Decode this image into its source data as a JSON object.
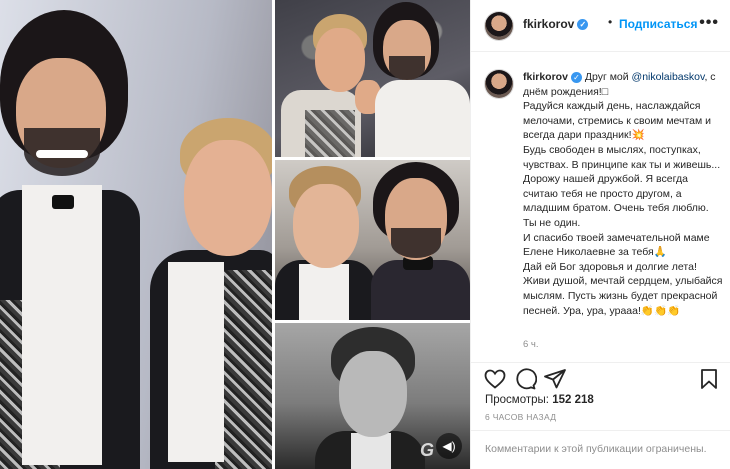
{
  "post": {
    "username": "fkirkorov",
    "follow_label": "Подписаться",
    "dot": "•",
    "more_glyph": "•••",
    "verified_glyph": "✓",
    "caption_user": "fkirkorov",
    "caption_pre": "Друг мой ",
    "caption_mention": "@nikolaibaskov",
    "caption_line1": ", с днём рождения!□",
    "caption_body1": "Радуйся каждый день, наслаждайся мелочами, стремись к своим мечтам и всегда дари праздник!",
    "caption_emoji1": "💥",
    "caption_body2": "Будь свободен в мыслях, поступках, чувствах. В принципе как ты и живешь... Дорожу нашей дружбой. Я всегда считаю тебя не просто другом, а младшим братом. Очень тебя люблю. Ты не один.\nИ спасибо твоей замечательной маме Елене Николаевне за тебя",
    "caption_emoji2": "🙏",
    "caption_body3": "Дай ей Бог здоровья и долгие лета!\nЖиви душой, мечтай сердцем, улыбайся мыслям. Пусть жизнь будет прекрасной песней. Ура, ура, урааа!",
    "caption_emoji3": "👏👏👏",
    "time_short": "6 ч.",
    "views_label": "Просмотры:",
    "views_count": "152 218",
    "time_ago": "6 ЧАСОВ НАЗАД",
    "comments_disabled": "Комментарии к этой публикации ограничены.",
    "watermark": "G",
    "play_glyph": "◀)"
  },
  "icons": [
    "heart-icon",
    "comment-icon",
    "share-icon",
    "bookmark-icon",
    "verified-icon",
    "more-icon",
    "sound-icon"
  ],
  "colors": {
    "link": "#0095f6",
    "mention": "#00376b",
    "verified": "#3897f0",
    "muted": "#8e8e8e",
    "text": "#262626",
    "divider": "#efefef"
  }
}
